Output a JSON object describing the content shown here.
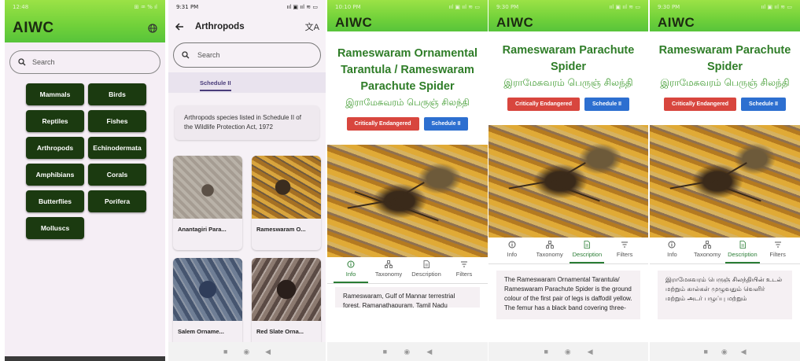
{
  "brand": {
    "name": "AIWC",
    "green": "#71d13a",
    "dark_green": "#1b3a10"
  },
  "phone1": {
    "status_time": "12:48",
    "status_right": "⊞ ♒ % ıl",
    "search_placeholder": "Search",
    "categories": [
      "Mammals",
      "Birds",
      "Reptiles",
      "Fishes",
      "Arthropods",
      "Echinodermata",
      "Amphibians",
      "Corals",
      "Butterflies",
      "Porifera",
      "Molluscs"
    ]
  },
  "phone2": {
    "status_time": "9:31 PM",
    "title": "Arthropods",
    "search_placeholder": "Search",
    "tab": "Schedule II",
    "description": "Arthropods species listed in Schedule II of the Wildlife Protection Act, 1972",
    "species": [
      "Anantagiri Para...",
      "Rameswaram O...",
      "Salem Orname...",
      "Red Slate Orna..."
    ]
  },
  "phone3": {
    "status_time": "10:10 PM",
    "title": "Rameswaram Ornamental Tarantula / Rameswaram Parachute Spider",
    "tamil": "இராமேசுவரம் பெருஞ் சிலந்தி",
    "badge_status": "Critically Endangered",
    "badge_schedule": "Schedule II",
    "tabs": [
      "Info",
      "Taxonomy",
      "Description",
      "Filters"
    ],
    "selected_tab": "Info",
    "content": "Rameswaram, Gulf of Mannar terrestrial forest, Ramanathapuram, Tamil Nadu"
  },
  "phone4": {
    "status_time": "9:30 PM",
    "title": "Rameswaram Parachute Spider",
    "tamil": "இராமேசுவரம் பெருஞ் சிலந்தி",
    "badge_status": "Critically Endangered",
    "badge_schedule": "Schedule II",
    "tabs": [
      "Info",
      "Taxonomy",
      "Description",
      "Filters"
    ],
    "selected_tab": "Description",
    "content": "The Rameswaram Ornamental Tarantula/ Rameswaram Parachute Spider is the ground colour of the first pair of legs is daffodil yellow. The femur has a black band covering three-"
  },
  "phone5": {
    "status_time": "9:30 PM",
    "title": "Rameswaram Parachute Spider",
    "tamil": "இராமேசுவரம் பெருஞ் சிலந்தி",
    "badge_status": "Critically Endangered",
    "badge_schedule": "Schedule II",
    "tabs": [
      "Info",
      "Taxonomy",
      "Description",
      "Filters"
    ],
    "selected_tab": "Description",
    "content": "இராமேசுவரம் பெருஞ் சிலந்தியின் உடல் மற்றும் கால்கள் முழுவதும் வெளிர் மற்றும் அடர் பழுப்பு மற்றும்"
  },
  "nav": {
    "back": "◀",
    "home": "◉",
    "recent": "■"
  }
}
